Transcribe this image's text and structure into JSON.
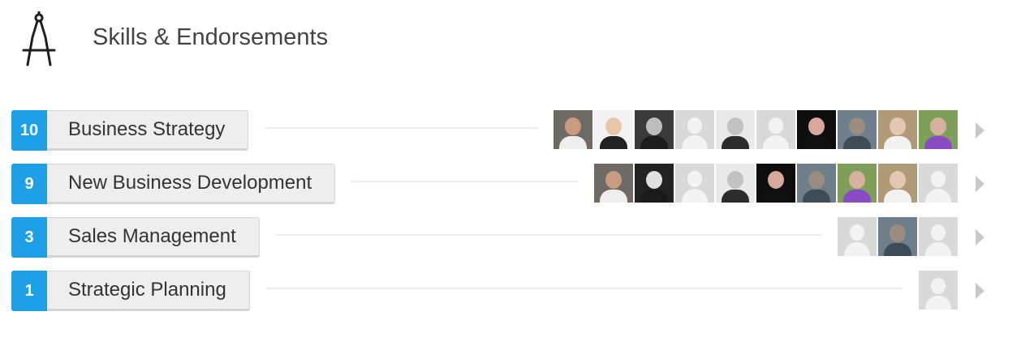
{
  "header": {
    "title": "Skills & Endorsements",
    "icon": "compass-icon"
  },
  "colors": {
    "count_badge": "#1ea0e6",
    "placeholder_avatar": "#d9d9d9"
  },
  "skills": [
    {
      "count": "10",
      "name": "Business Strategy",
      "endorsers": [
        {
          "kind": "photo",
          "bg": "#6e6a64",
          "face": "#c89b80",
          "shirt": "#eeeeee"
        },
        {
          "kind": "photo",
          "bg": "#f2f2f2",
          "face": "#e8c8a8",
          "shirt": "#222222"
        },
        {
          "kind": "photo",
          "bg": "#3a3a3a",
          "face": "#bdbdbd",
          "shirt": "#1c1c1c"
        },
        {
          "kind": "placeholder"
        },
        {
          "kind": "photo",
          "bg": "#e9e9e9",
          "face": "#c2c2c2",
          "shirt": "#2c2c2c"
        },
        {
          "kind": "placeholder"
        },
        {
          "kind": "photo",
          "bg": "#0d0d0d",
          "face": "#d8a79b",
          "shirt": "#101010"
        },
        {
          "kind": "photo",
          "bg": "#6f7f8a",
          "face": "#9a8d80",
          "shirt": "#3e4c55"
        },
        {
          "kind": "photo",
          "bg": "#b09a78",
          "face": "#e2c8b0",
          "shirt": "#f2f2f2"
        },
        {
          "kind": "photo",
          "bg": "#7fa05a",
          "face": "#d8b0a0",
          "shirt": "#8a4cc2"
        }
      ]
    },
    {
      "count": "9",
      "name": "New Business Development",
      "endorsers": [
        {
          "kind": "photo",
          "bg": "#6e6a64",
          "face": "#c89b80",
          "shirt": "#eeeeee"
        },
        {
          "kind": "photo",
          "bg": "#222222",
          "face": "#e0e0e0",
          "shirt": "#1a1a1a"
        },
        {
          "kind": "placeholder"
        },
        {
          "kind": "photo",
          "bg": "#e9e9e9",
          "face": "#c2c2c2",
          "shirt": "#2c2c2c"
        },
        {
          "kind": "photo",
          "bg": "#0d0d0d",
          "face": "#d8a79b",
          "shirt": "#101010"
        },
        {
          "kind": "photo",
          "bg": "#6f7f8a",
          "face": "#9a8d80",
          "shirt": "#3e4c55"
        },
        {
          "kind": "photo",
          "bg": "#7fa05a",
          "face": "#d8b0a0",
          "shirt": "#8a4cc2"
        },
        {
          "kind": "photo",
          "bg": "#b09a78",
          "face": "#e2c8b0",
          "shirt": "#f2f2f2"
        },
        {
          "kind": "placeholder"
        }
      ]
    },
    {
      "count": "3",
      "name": "Sales Management",
      "endorsers": [
        {
          "kind": "placeholder"
        },
        {
          "kind": "photo",
          "bg": "#6f7f8a",
          "face": "#9a8d80",
          "shirt": "#3e4c55"
        },
        {
          "kind": "placeholder"
        }
      ]
    },
    {
      "count": "1",
      "name": "Strategic Planning",
      "endorsers": [
        {
          "kind": "placeholder"
        }
      ]
    }
  ]
}
